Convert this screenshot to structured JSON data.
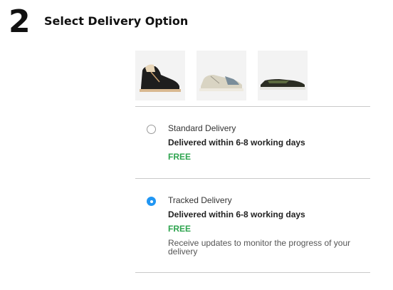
{
  "step": {
    "number": "2",
    "title": "Select Delivery Option"
  },
  "products": [
    {
      "icon": "black-hightop-sneaker-icon"
    },
    {
      "icon": "cream-lowtop-sneaker-icon"
    },
    {
      "icon": "olive-slip-sneaker-icon"
    }
  ],
  "options": [
    {
      "name": "Standard Delivery",
      "time": "Delivered within 6-8 working days",
      "price": "FREE",
      "selected": false
    },
    {
      "name": "Tracked Delivery",
      "time": "Delivered within 6-8 working days",
      "price": "FREE",
      "note": "Receive updates to monitor the progress of your delivery",
      "selected": true
    }
  ],
  "colors": {
    "accent": "#2196f3",
    "price": "#2ea44f",
    "divider": "#c9c9c9"
  }
}
